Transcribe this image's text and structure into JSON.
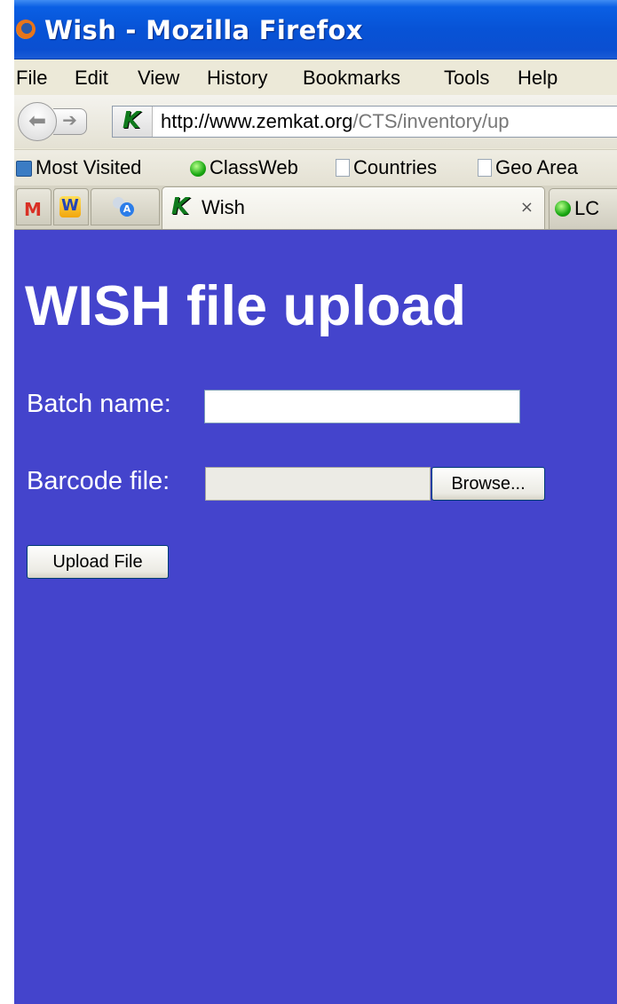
{
  "window": {
    "title": "Wish - Mozilla Firefox"
  },
  "menu": {
    "file": "File",
    "edit": "Edit",
    "view": "View",
    "history": "History",
    "bookmarks": "Bookmarks",
    "tools": "Tools",
    "help": "Help"
  },
  "navbar": {
    "url_host": "http://www.zemkat.org",
    "url_path": "/CTS/inventory/up"
  },
  "bookmarks": [
    "Most Visited",
    "ClassWeb",
    "Countries",
    "Geo Area"
  ],
  "tabs": {
    "active_label": "Wish",
    "close_glyph": "×",
    "next_label": "LC"
  },
  "page": {
    "title": "WISH file upload",
    "batch_label": "Batch name:",
    "batch_value": "",
    "barcode_label": "Barcode file:",
    "browse_label": "Browse...",
    "upload_label": "Upload File"
  },
  "colors": {
    "page_background": "#4444cc",
    "titlebar": "#0753d6"
  }
}
